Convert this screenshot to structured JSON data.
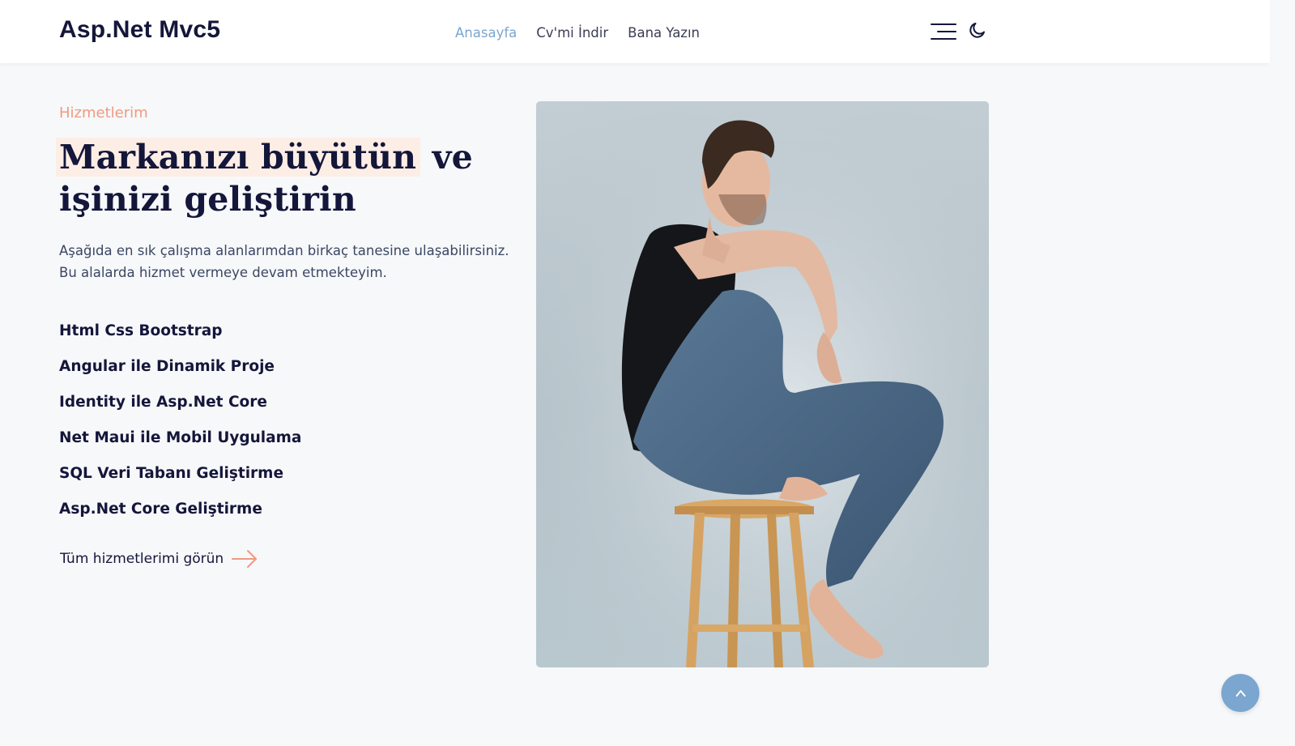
{
  "header": {
    "brand": "Asp.Net Mvc5",
    "nav": [
      {
        "label": "Anasayfa",
        "active": true
      },
      {
        "label": "Cv'mi İndir",
        "active": false
      },
      {
        "label": "Bana Yazın",
        "active": false
      }
    ],
    "icons": [
      "menu-icon",
      "moon-icon"
    ]
  },
  "services_section": {
    "eyebrow": "Hizmetlerim",
    "headline_highlight": "Markanızı büyütün",
    "headline_rest": " ve işinizi geliştirin",
    "description": "Aşağıda en sık çalışma alanlarımdan birkaç tanesine ulaşabilirsiniz. Bu alalarda hizmet vermeye devam etmekteyim.",
    "items": [
      "Html Css Bootstrap",
      "Angular ile Dinamik Proje",
      "Identity ile Asp.Net Core",
      "Net Maui ile Mobil Uygulama",
      "SQL Veri Tabanı Geliştirme",
      "Asp.Net Core Geliştirme"
    ],
    "cta_label": "Tüm hizmetlerimi görün"
  },
  "colors": {
    "accent": "#f09a80",
    "nav_active": "#7aa6cf",
    "highlight_bg": "#fdeee5",
    "text_dark": "#14163a"
  }
}
